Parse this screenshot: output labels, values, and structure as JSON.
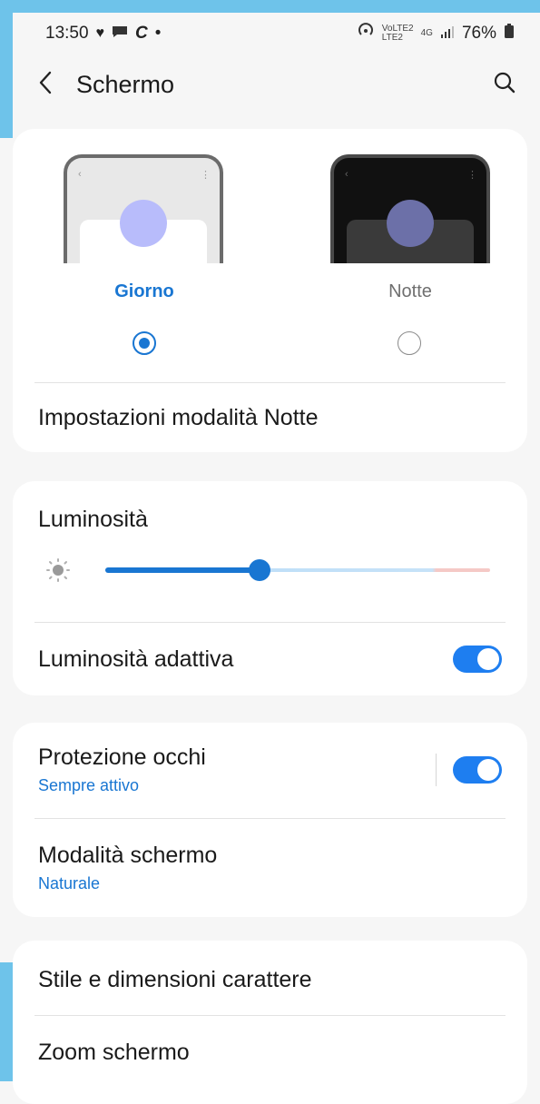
{
  "status_bar": {
    "time": "13:50",
    "network_top": "VoLTE2",
    "network_bottom": "LTE2",
    "net_4g": "4G",
    "battery": "76%"
  },
  "header": {
    "title": "Schermo"
  },
  "theme": {
    "day_label": "Giorno",
    "night_label": "Notte",
    "selected": "Giorno",
    "night_settings_label": "Impostazioni modalità Notte"
  },
  "brightness": {
    "label": "Luminosità",
    "level": 0.4
  },
  "adaptive": {
    "label": "Luminosità adattiva",
    "enabled": true
  },
  "eye_comfort": {
    "label": "Protezione occhi",
    "sub": "Sempre attivo",
    "enabled": true
  },
  "screen_mode": {
    "label": "Modalità schermo",
    "sub": "Naturale"
  },
  "font": {
    "label": "Stile e dimensioni carattere"
  },
  "zoom": {
    "label": "Zoom schermo"
  },
  "colors": {
    "accent": "#1976d2",
    "toggle_on": "#1e7ef0",
    "frame_accent": "#6ec3ea"
  }
}
